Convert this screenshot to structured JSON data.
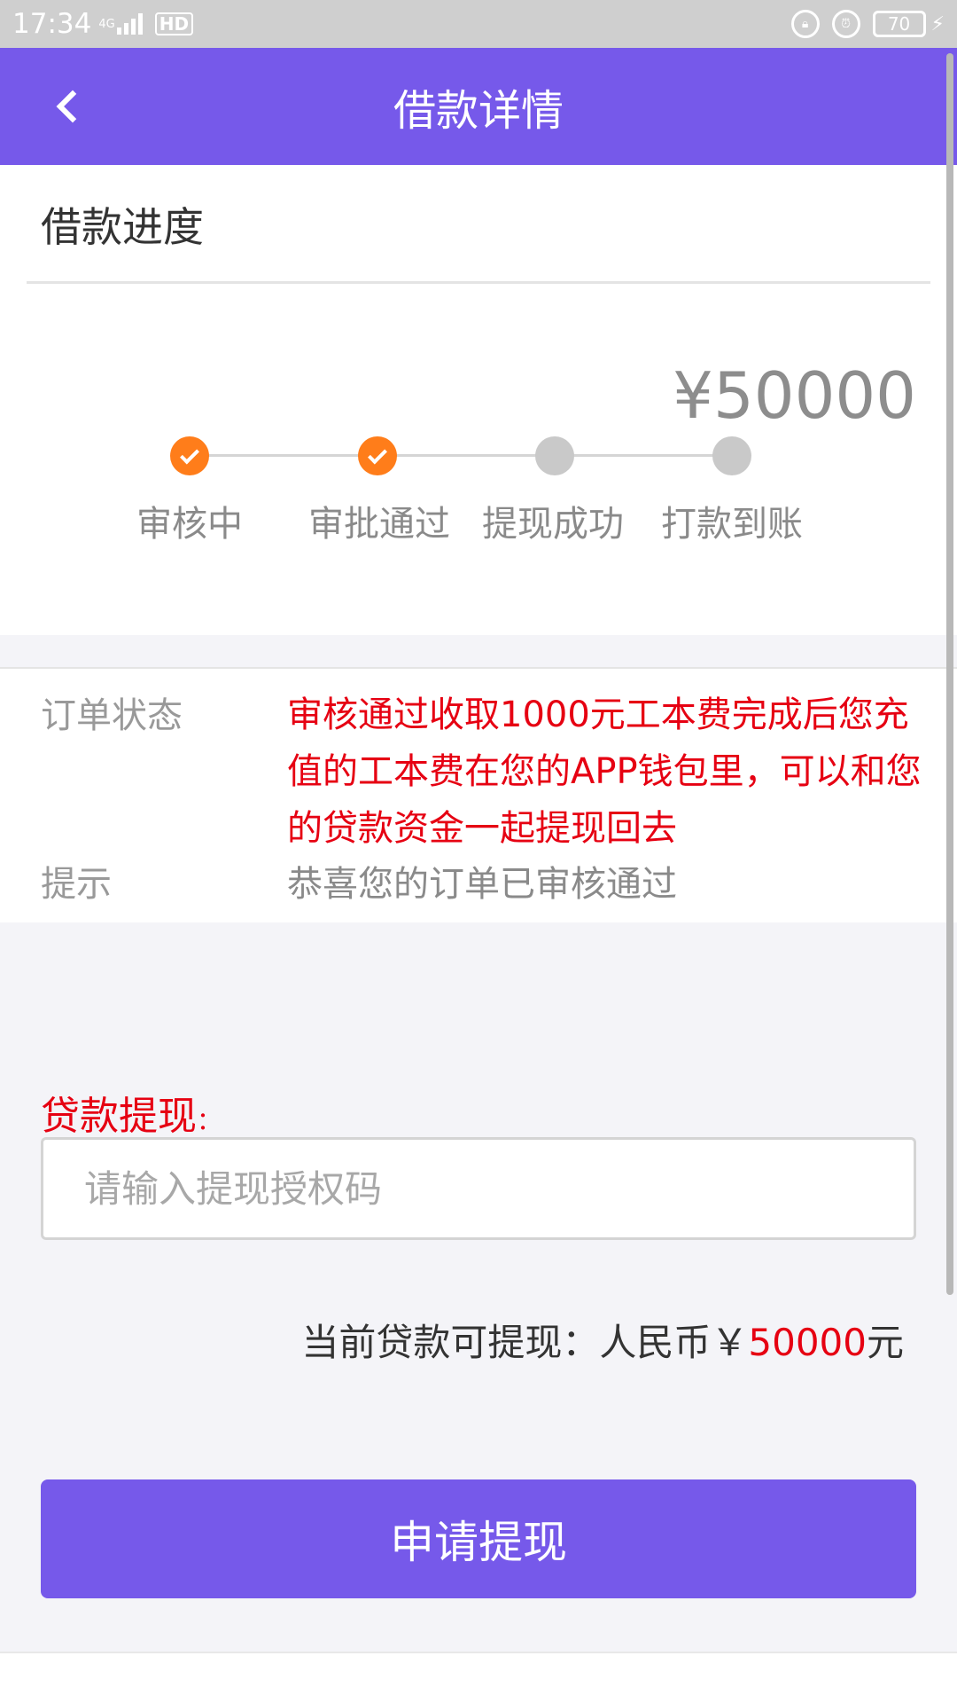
{
  "status_bar": {
    "time": "17:34",
    "network": "4G",
    "hd": "HD",
    "battery": "70"
  },
  "header": {
    "title": "借款详情"
  },
  "progress": {
    "section_title": "借款进度",
    "amount": "¥50000",
    "steps": [
      {
        "label": "审核中",
        "done": true
      },
      {
        "label": "审批通过",
        "done": true
      },
      {
        "label": "提现成功",
        "done": false
      },
      {
        "label": "打款到账",
        "done": false
      }
    ],
    "done_color": "#ff7d1a",
    "pending_color": "#c9c9c9"
  },
  "order": {
    "status_label": "订单状态",
    "status_text": "审核通过收取1000元工本费完成后您充值的工本费在您的APP钱包里，可以和您的贷款资金一起提现回去",
    "tip_label": "提示",
    "tip_text": "恭喜您的订单已审核通过"
  },
  "withdraw": {
    "label": "贷款提现",
    "label_suffix": "：",
    "input_placeholder": "请输入提现授权码",
    "balance_prefix": "当前贷款可提现：人民币￥",
    "balance_amount": "50000",
    "balance_suffix": "元",
    "submit_label": "申请提现"
  },
  "colors": {
    "brand": "#7659ea",
    "alert": "#e60012"
  }
}
